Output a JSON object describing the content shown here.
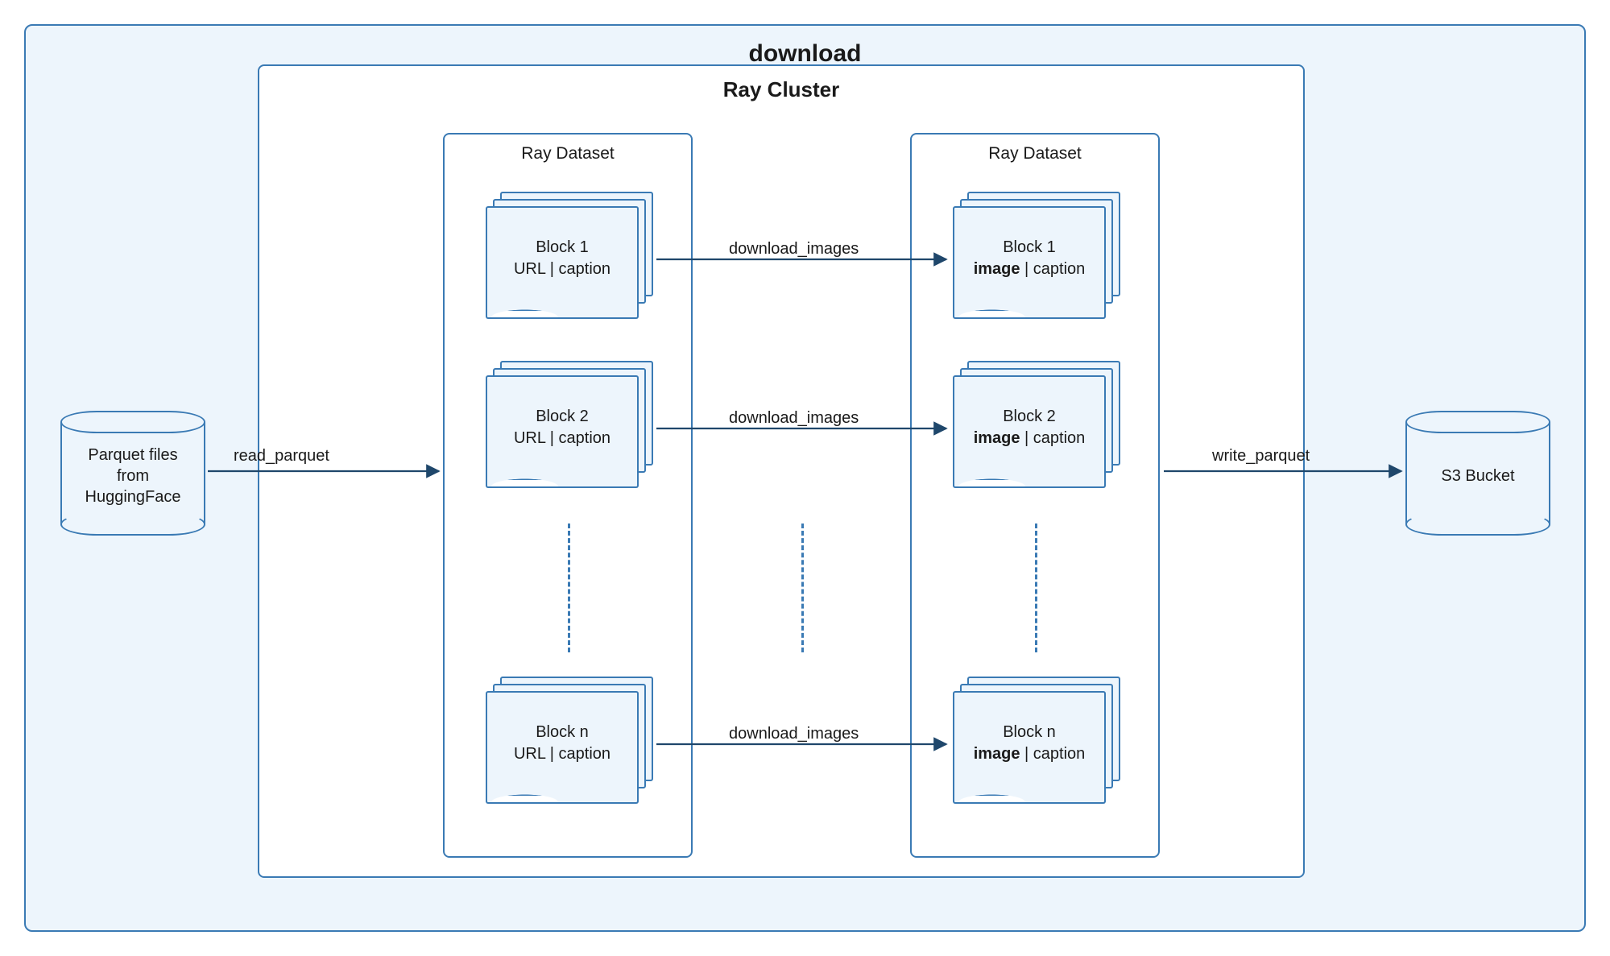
{
  "outer": {
    "title": "download"
  },
  "cluster": {
    "title": "Ray Cluster"
  },
  "datasets": {
    "left": {
      "title": "Ray Dataset"
    },
    "right": {
      "title": "Ray Dataset"
    }
  },
  "source": {
    "label": "Parquet files\nfrom\nHuggingFace"
  },
  "sink": {
    "label": "S3 Bucket"
  },
  "edges": {
    "read": "read_parquet",
    "map": "download_images",
    "write": "write_parquet"
  },
  "left_blocks": [
    {
      "row1": "Block 1",
      "row2_plain": "URL | caption"
    },
    {
      "row1": "Block 2",
      "row2_plain": "URL | caption"
    },
    {
      "row1": "Block n",
      "row2_plain": "URL | caption"
    }
  ],
  "right_blocks": [
    {
      "row1": "Block 1",
      "row2_bold": "image",
      "row2_tail": " | caption"
    },
    {
      "row1": "Block 2",
      "row2_bold": "image",
      "row2_tail": " | caption"
    },
    {
      "row1": "Block n",
      "row2_bold": "image",
      "row2_tail": " | caption"
    }
  ]
}
